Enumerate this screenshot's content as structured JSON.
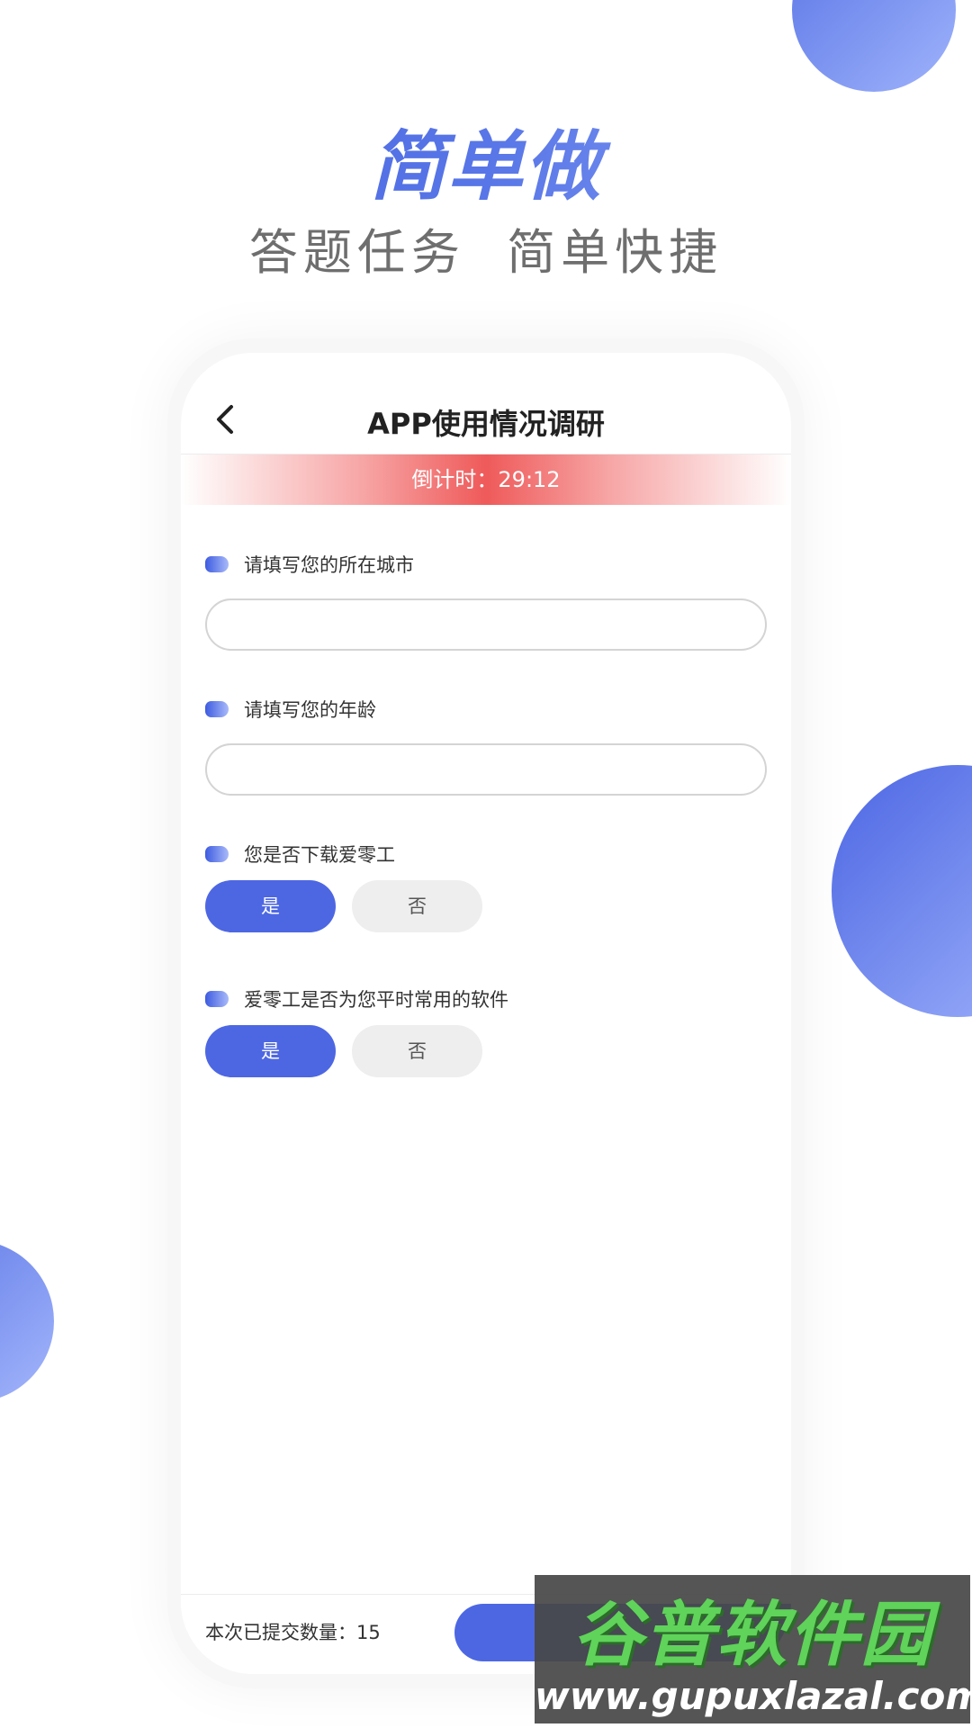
{
  "hero": {
    "title": "简单做",
    "subtitle": "答题任务  简单快捷"
  },
  "nav": {
    "title": "APP使用情况调研",
    "back_icon": "chevron-left-icon"
  },
  "countdown": {
    "text": "倒计时：29:12",
    "color": "#ef5a5a"
  },
  "questions": [
    {
      "label": "请填写您的所在城市",
      "type": "text",
      "value": ""
    },
    {
      "label": "请填写您的年龄",
      "type": "text",
      "value": ""
    },
    {
      "label": "您是否下载爱零工",
      "type": "choice",
      "options": [
        "是",
        "否"
      ],
      "selected": "是"
    },
    {
      "label": "爱零工是否为您平时常用的软件",
      "type": "choice",
      "options": [
        "是",
        "否"
      ],
      "selected": "是"
    }
  ],
  "footer": {
    "submit_count": "本次已提交数量：15"
  },
  "watermark": {
    "logo_text": "谷普软件园",
    "url": "www.gupuxlazal.com"
  },
  "colors": {
    "accent": "#4d67e3",
    "unselected": "#eeeeee",
    "text": "#333333"
  }
}
